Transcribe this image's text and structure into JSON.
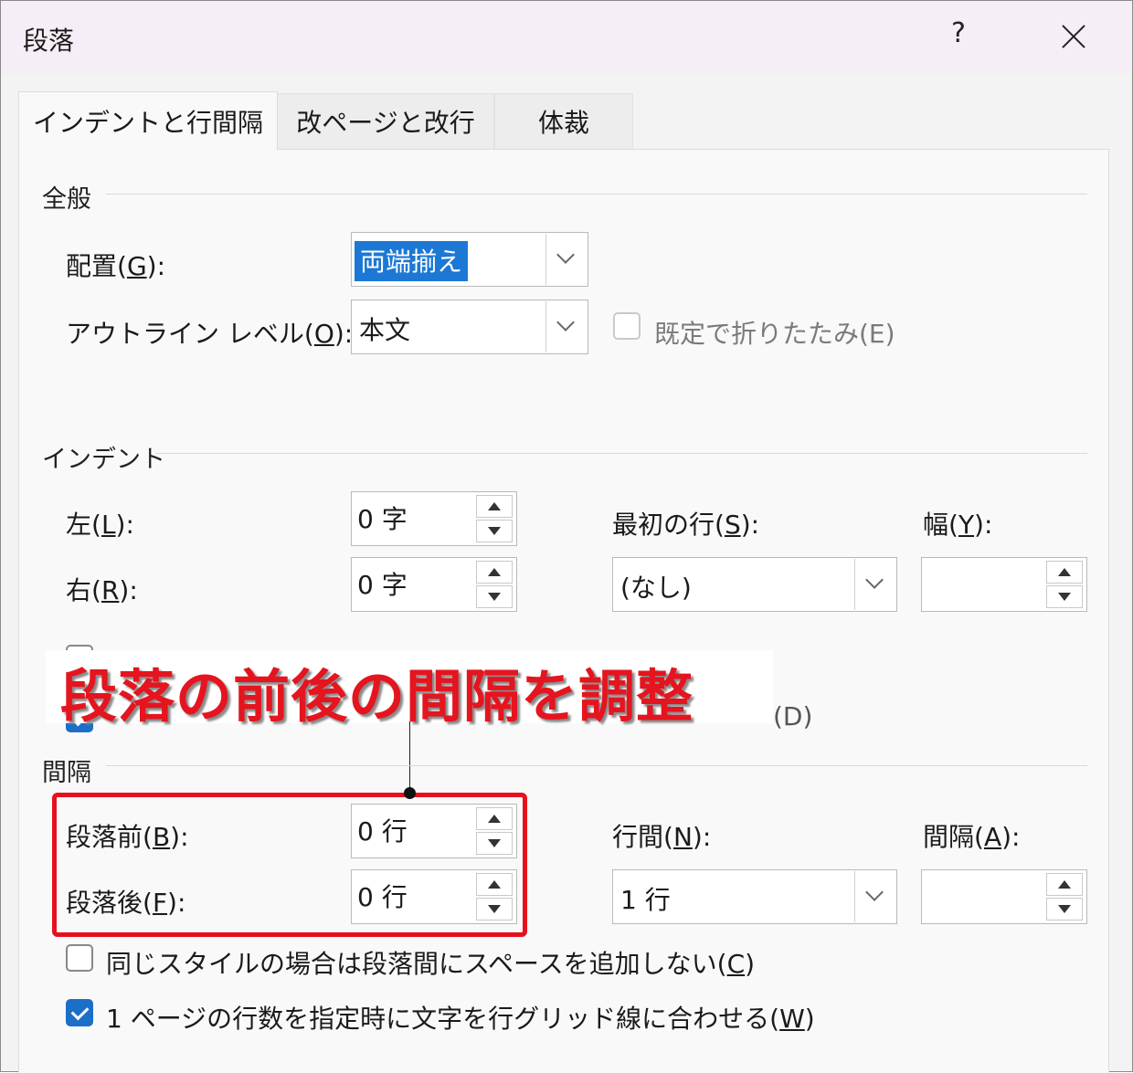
{
  "dialog": {
    "title": "段落",
    "help": "?"
  },
  "tabs": [
    {
      "label": "インデントと行間隔"
    },
    {
      "label": "改ページと改行"
    },
    {
      "label": "体裁"
    }
  ],
  "general": {
    "heading": "全般",
    "alignment_label_prefix": "配置(",
    "alignment_key": "G",
    "alignment_label_suffix": "):",
    "alignment_value": "両端揃え",
    "outline_label_prefix": "アウトライン レベル(",
    "outline_key": "O",
    "outline_label_suffix": "):",
    "outline_value": "本文",
    "collapse_label": "既定で折りたたみ(E)"
  },
  "indent": {
    "heading": "インデント",
    "left_prefix": "左(",
    "left_key": "L",
    "left_suffix": "):",
    "left_value": "0 字",
    "right_prefix": "右(",
    "right_key": "R",
    "right_suffix": "):",
    "right_value": "0 字",
    "first_line_prefix": "最初の行(",
    "first_line_key": "S",
    "first_line_suffix": "):",
    "first_line_value": "(なし)",
    "width_prefix": "幅(",
    "width_key": "Y",
    "width_suffix": "):",
    "width_value": "",
    "hidden_option_tail": "(D)"
  },
  "spacing": {
    "heading": "間隔",
    "before_prefix": "段落前(",
    "before_key": "B",
    "before_suffix": "):",
    "before_value": "0 行",
    "after_prefix": "段落後(",
    "after_key": "F",
    "after_suffix": "):",
    "after_value": "0 行",
    "line_spacing_prefix": "行間(",
    "line_spacing_key": "N",
    "line_spacing_suffix": "):",
    "line_spacing_value": "1 行",
    "amount_prefix": "間隔(",
    "amount_key": "A",
    "amount_suffix": "):",
    "amount_value": "",
    "no_space_prefix": "同じスタイルの場合は段落間にスペースを追加しない(",
    "no_space_key": "C",
    "no_space_suffix": ")",
    "no_space_checked": false,
    "grid_prefix": "1 ページの行数を指定時に文字を行グリッド線に合わせる(",
    "grid_key": "W",
    "grid_suffix": ")",
    "grid_checked": true
  },
  "annotation": {
    "callout": "段落の前後の間隔を調整",
    "box_color": "#e8101c"
  },
  "colors": {
    "accent": "#1c78d4",
    "callout": "#e5141e"
  }
}
